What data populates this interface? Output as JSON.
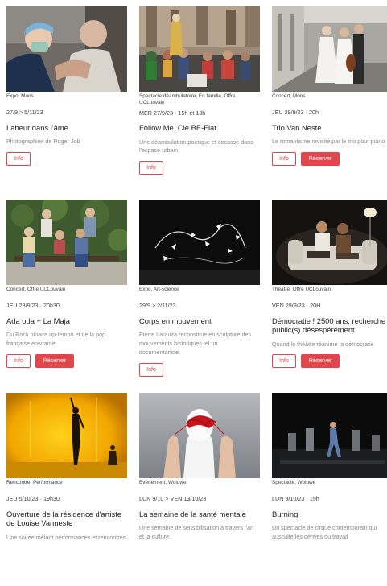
{
  "buttons": {
    "info": "Info",
    "book": "Réserver"
  },
  "events": [
    {
      "category": "Expo, Mons",
      "date": "27/9 > 5/11/23",
      "title": "Labeur dans l'âme",
      "desc": "Photographies de Roger Job",
      "book": false,
      "image": "medical-portrait"
    },
    {
      "category": "Spectacle déambulatoire, En famille, Offre UCLouvain",
      "date": "MER 27/9/23 · 15h et 18h",
      "title": "Follow Me, Cie BE-Flat",
      "desc": "Une déambulation poétique et cocasse dans l'espace urbain",
      "book": false,
      "image": "street-crowd"
    },
    {
      "category": "Concert, Mons",
      "date": "JEU 28/9/23 · 20h",
      "title": "Trio Van Neste",
      "desc": "Le romantisme revisité par le trio pour piano",
      "book": true,
      "image": "trio-musicians"
    },
    {
      "category": "Concert, Offre UCLouvain",
      "date": "JEU 28/9/23 · 20h30",
      "title": "Ada oda + La Maja",
      "desc": "Du Rock binaire up-tempo et de la pop française enivrante",
      "book": true,
      "image": "band-bench"
    },
    {
      "category": "Expo, Art-science",
      "date": "29/9 > 2/11/23",
      "title": "Corps en mouvement",
      "desc": "Pierre Larauza reconstitue en sculpture des mouvements historiques tel un documentariste.",
      "book": false,
      "image": "light-sculpture"
    },
    {
      "category": "Théâtre, Offre UCLouvain",
      "date": "VEN 29/9/23 · 20H",
      "title": "Démocratie ! 2500 ans, recherche public(s) désespérément",
      "desc": "Quand le théâtre réanime la démocratie",
      "book": true,
      "image": "theatre-sofa"
    },
    {
      "category": "Rencontre, Performance",
      "date": "JEU 5/10/23 · 19h30",
      "title": "Ouverture de la résidence d'artiste de Louise Vanneste",
      "desc": "Une soirée mêlant performances et rencontres",
      "book": false,
      "image": "yellow-dancer"
    },
    {
      "category": "Evénement, Woluwe",
      "date": "LUN 9/10 > VEN 13/10/23",
      "title": "La semaine de la santé mentale",
      "desc": "Une semaine de sensibilisation à travers l'art et la culture.",
      "book": false,
      "image": "head-thread"
    },
    {
      "category": "Spectacle, Woluwe",
      "date": "LUN 9/10/23 · 19h",
      "title": "Burning",
      "desc": "Un spectacle de cirque contemporain qui ausculte les dérives du travail",
      "book": false,
      "image": "stage-burning"
    }
  ]
}
